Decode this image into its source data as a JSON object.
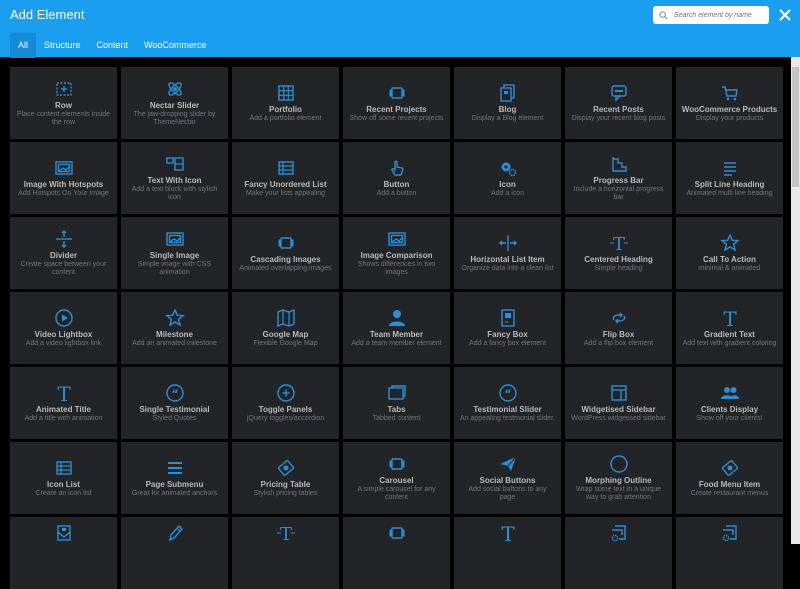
{
  "header": {
    "title": "Add Element",
    "search_placeholder": "Search element by name",
    "tabs": [
      {
        "label": "All",
        "active": true
      },
      {
        "label": "Structure",
        "active": false
      },
      {
        "label": "Content",
        "active": false
      },
      {
        "label": "WooCommerce",
        "active": false
      }
    ]
  },
  "colors": {
    "accent": "#1a9ff0",
    "icon": "#2c8fd6",
    "card_bg": "#222427"
  },
  "elements": [
    {
      "name": "Row",
      "desc": "Place content elements inside the row",
      "icon": "row"
    },
    {
      "name": "Nectar Slider",
      "desc": "The jaw-dropping slider by ThemeNectar",
      "icon": "atom"
    },
    {
      "name": "Portfolio",
      "desc": "Add a portfolio element",
      "icon": "grid"
    },
    {
      "name": "Recent Projects",
      "desc": "Show off some recent projects",
      "icon": "carousel"
    },
    {
      "name": "Blog",
      "desc": "Display a Blog element",
      "icon": "blog"
    },
    {
      "name": "Recent Posts",
      "desc": "Display your recent blog posts",
      "icon": "chat"
    },
    {
      "name": "WooCommerce Products",
      "desc": "Display your products",
      "icon": "cart"
    },
    {
      "name": "Image With Hotspots",
      "desc": "Add Hotspots On Your Image",
      "icon": "image"
    },
    {
      "name": "Text With Icon",
      "desc": "Add a text block with stylish icon",
      "icon": "texticon"
    },
    {
      "name": "Fancy Unordered List",
      "desc": "Make your lists appealing",
      "icon": "list"
    },
    {
      "name": "Button",
      "desc": "Add a button",
      "icon": "hand"
    },
    {
      "name": "Icon",
      "desc": "Add a icon",
      "icon": "gears"
    },
    {
      "name": "Progress Bar",
      "desc": "Include a horizontal progress bar",
      "icon": "stairs"
    },
    {
      "name": "Split Line Heading",
      "desc": "Animated multi line heading",
      "icon": "lines"
    },
    {
      "name": "Divider",
      "desc": "Create space between your content",
      "icon": "divider"
    },
    {
      "name": "Single Image",
      "desc": "Simple image with CSS animation",
      "icon": "image"
    },
    {
      "name": "Cascading Images",
      "desc": "Animated overlapping images",
      "icon": "carousel"
    },
    {
      "name": "Image Comparison",
      "desc": "Shows differences in two images",
      "icon": "image"
    },
    {
      "name": "Horizontal List Item",
      "desc": "Organize data into a clean list",
      "icon": "hsplit"
    },
    {
      "name": "Centered Heading",
      "desc": "Simple heading",
      "icon": "theading"
    },
    {
      "name": "Call To Action",
      "desc": "minimal & animated",
      "icon": "star"
    },
    {
      "name": "Video Lightbox",
      "desc": "Add a video lightbox link",
      "icon": "play"
    },
    {
      "name": "Milestone",
      "desc": "Add an animated milestone",
      "icon": "star"
    },
    {
      "name": "Google Map",
      "desc": "Flexible Google Map",
      "icon": "map"
    },
    {
      "name": "Team Member",
      "desc": "Add a team member element",
      "icon": "person"
    },
    {
      "name": "Fancy Box",
      "desc": "Add a fancy box element",
      "icon": "fancybox"
    },
    {
      "name": "Flip Box",
      "desc": "Add a flip box element",
      "icon": "flip"
    },
    {
      "name": "Gradient Text",
      "desc": "Add text with gradient coloring",
      "icon": "t"
    },
    {
      "name": "Animated Title",
      "desc": "Add a title with animation",
      "icon": "t"
    },
    {
      "name": "Single Testimonial",
      "desc": "Styled Quotes",
      "icon": "quote"
    },
    {
      "name": "Toggle Panels",
      "desc": "jQuery toggles/accordion",
      "icon": "plus-circle"
    },
    {
      "name": "Tabs",
      "desc": "Tabbed content",
      "icon": "tabs"
    },
    {
      "name": "Testimonial Slider",
      "desc": "An appealing testmonial slider.",
      "icon": "quote"
    },
    {
      "name": "Widgetised Sidebar",
      "desc": "WordPress widgetised sidebar",
      "icon": "sidebar"
    },
    {
      "name": "Clients Display",
      "desc": "Show off your clients!",
      "icon": "users"
    },
    {
      "name": "Icon List",
      "desc": "Create an icon list",
      "icon": "list"
    },
    {
      "name": "Page Submenu",
      "desc": "Great for animated anchors",
      "icon": "menu"
    },
    {
      "name": "Pricing Table",
      "desc": "Stylish pricing tables",
      "icon": "money"
    },
    {
      "name": "Carousel",
      "desc": "A simple carousel for any content",
      "icon": "carousel"
    },
    {
      "name": "Social Buttons",
      "desc": "Add social buttons to any page",
      "icon": "plane"
    },
    {
      "name": "Morphing Outline",
      "desc": "Wrap some text in a unique way to grab attention",
      "icon": "circle"
    },
    {
      "name": "Food Menu Item",
      "desc": "Create restaurant menus",
      "icon": "money"
    },
    {
      "name": "",
      "desc": "",
      "icon": "mail"
    },
    {
      "name": "",
      "desc": "",
      "icon": "pencil"
    },
    {
      "name": "",
      "desc": "",
      "icon": "theading"
    },
    {
      "name": "",
      "desc": "",
      "icon": "carousel"
    },
    {
      "name": "",
      "desc": "",
      "icon": "t"
    },
    {
      "name": "",
      "desc": "",
      "icon": "gear-doc"
    },
    {
      "name": "",
      "desc": "",
      "icon": "gear-doc"
    }
  ]
}
